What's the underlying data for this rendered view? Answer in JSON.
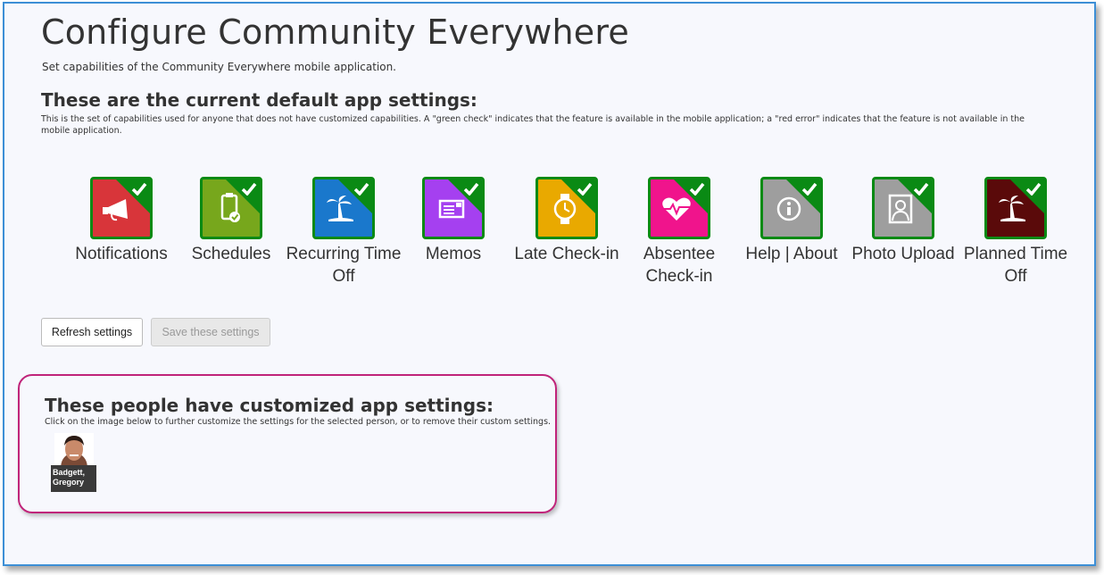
{
  "page": {
    "title": "Configure Community Everywhere",
    "subtitle": "Set capabilities of the Community Everywhere mobile application."
  },
  "defaults": {
    "heading": "These are the current default app settings:",
    "description": "This is the set of capabilities used for anyone that does not have customized capabilities. A \"green check\" indicates that the feature is available in the mobile application; a \"red error\" indicates that the feature is not available in the mobile application.",
    "features": [
      {
        "label": "Notifications",
        "color": "#d8353a",
        "icon": "megaphone-icon",
        "enabled": true
      },
      {
        "label": "Schedules",
        "color": "#77a71c",
        "icon": "clipboard-check-icon",
        "enabled": true
      },
      {
        "label": "Recurring Time Off",
        "color": "#1a78cc",
        "icon": "palm-tree-icon",
        "enabled": true
      },
      {
        "label": "Memos",
        "color": "#a540f0",
        "icon": "memo-card-icon",
        "enabled": true
      },
      {
        "label": "Late Check-in",
        "color": "#e9a900",
        "icon": "watch-icon",
        "enabled": true
      },
      {
        "label": "Absentee Check-in",
        "color": "#f0148c",
        "icon": "heartbeat-icon",
        "enabled": true
      },
      {
        "label": "Help | About",
        "color": "#9e9e9e",
        "icon": "info-icon",
        "enabled": true
      },
      {
        "label": "Photo Upload",
        "color": "#9e9e9e",
        "icon": "person-photo-icon",
        "enabled": true
      },
      {
        "label": "Planned Time Off",
        "color": "#5a0a0a",
        "icon": "palm-tree-icon",
        "enabled": true
      }
    ]
  },
  "buttons": {
    "refresh": "Refresh settings",
    "save": "Save these settings"
  },
  "customized": {
    "heading": "These people have customized app settings:",
    "description": "Click on the image below to further customize the settings for the selected person, or to remove their custom settings.",
    "people": [
      {
        "name_line1": "Badgett,",
        "name_line2": "Gregory"
      }
    ]
  },
  "colors": {
    "check_green": "#0a8a14",
    "frame_border": "#3d8fd6",
    "highlight_border": "#c0247a"
  }
}
